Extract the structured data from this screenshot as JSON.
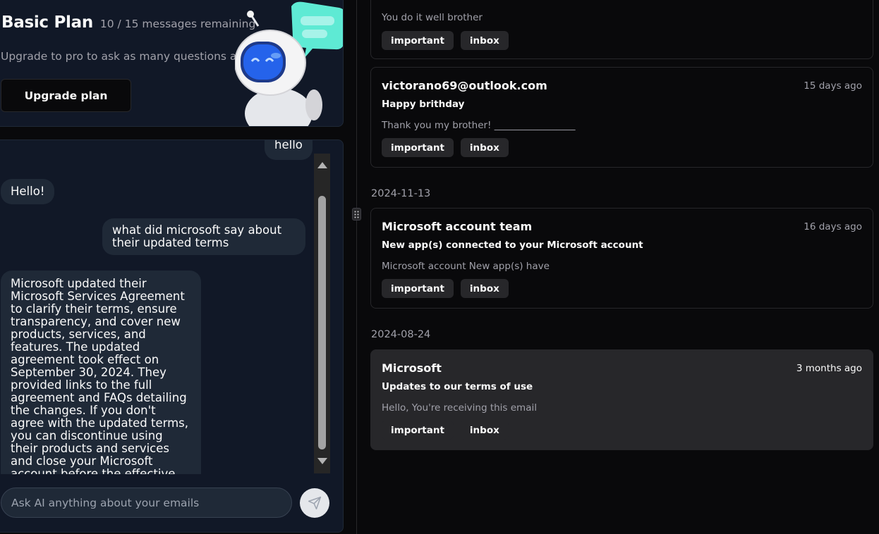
{
  "plan": {
    "title": "Basic Plan",
    "remaining": "10 / 15 messages remaining",
    "description": "Upgrade to pro to ask as many questions as you",
    "upgrade_label": "Upgrade plan"
  },
  "chat": {
    "messages": [
      {
        "role": "user",
        "text": "hello"
      },
      {
        "role": "ai",
        "text": "Hello!"
      },
      {
        "role": "user",
        "text": "what did microsoft say about their updated terms"
      },
      {
        "role": "ai",
        "text": "Microsoft updated their Microsoft Services Agreement to clarify their terms, ensure transparency, and cover new products, services, and features. The updated agreement took effect on September 30, 2024. They provided links to the full agreement and FAQs detailing the changes. If you don't agree with the updated terms, you can discontinue using their products and services and close your Microsoft account before the effective date."
      }
    ],
    "input_placeholder": "Ask AI anything about your emails",
    "input_value": ""
  },
  "emails": {
    "groups": [
      {
        "date": "",
        "items": [
          {
            "sender": "",
            "time": "",
            "subject": "",
            "preview": "You do it well brother",
            "tags": [
              "important",
              "inbox"
            ]
          },
          {
            "sender": "victorano69@outlook.com",
            "time": "15 days ago",
            "subject": "Happy brithday",
            "preview": "Thank you my brother! _________________",
            "tags": [
              "important",
              "inbox"
            ]
          }
        ]
      },
      {
        "date": "2024-11-13",
        "items": [
          {
            "sender": "Microsoft account team",
            "time": "16 days ago",
            "subject": "New app(s) connected to your Microsoft account",
            "preview": "Microsoft account New app(s) have",
            "tags": [
              "important",
              "inbox"
            ]
          }
        ]
      },
      {
        "date": "2024-08-24",
        "items": [
          {
            "sender": "Microsoft",
            "time": "3 months ago",
            "subject": "Updates to our terms of use",
            "preview": "Hello, You're receiving this email",
            "tags": [
              "important",
              "inbox"
            ],
            "selected": true
          }
        ]
      }
    ]
  },
  "colors": {
    "background": "#09090b",
    "panel": "#111827",
    "bubble": "#1f2937",
    "selected_card": "#27272a",
    "robot_visor": "#1d4ed8",
    "robot_bubble": "#5eead4"
  },
  "icons": {
    "send": "send-icon",
    "drag": "grip-vertical-icon",
    "robot": "robot-mascot-icon"
  }
}
